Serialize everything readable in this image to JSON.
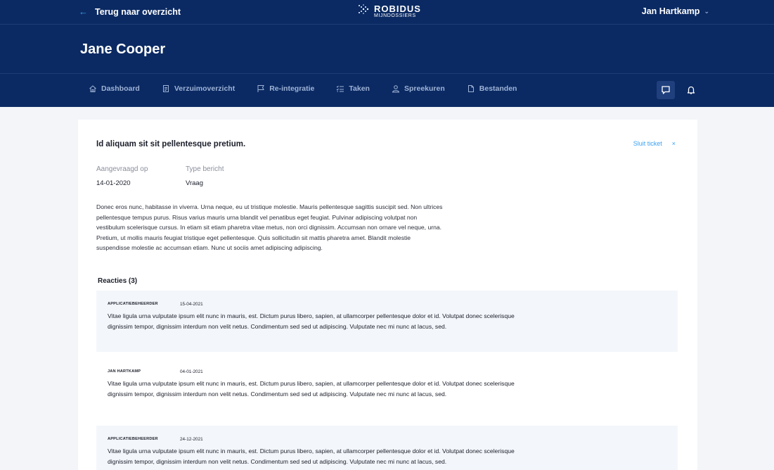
{
  "header": {
    "back_label": "Terug naar overzicht",
    "logo_main": "ROBIDUS",
    "logo_sub": "MIJNDOSSIERS",
    "user_name": "Jan Hartkamp",
    "page_title": "Jane Cooper"
  },
  "nav": {
    "items": [
      {
        "label": "Dashboard",
        "icon": "home-icon"
      },
      {
        "label": "Verzuimoverzicht",
        "icon": "document-icon"
      },
      {
        "label": "Re-integratie",
        "icon": "flag-icon"
      },
      {
        "label": "Taken",
        "icon": "checklist-icon"
      },
      {
        "label": "Spreekuren",
        "icon": "person-icon"
      },
      {
        "label": "Bestanden",
        "icon": "file-icon"
      }
    ],
    "actions": [
      {
        "icon": "chat-icon",
        "active": true
      },
      {
        "icon": "bell-icon",
        "active": false
      }
    ]
  },
  "ticket": {
    "title": "Id aliquam sit sit pellentesque pretium.",
    "close_label": "Sluit ticket",
    "close_icon": "×",
    "requested_label": "Aangevraagd op",
    "requested_value": "14-01-2020",
    "type_label": "Type bericht",
    "type_value": "Vraag",
    "body": "Donec eros nunc, habitasse in viverra. Urna neque, eu ut tristique molestie. Mauris pellentesque sagittis suscipit sed. Non ultrices pellentesque tempus purus. Risus varius mauris urna blandit vel penatibus eget feugiat. Pulvinar adipiscing volutpat non vestibulum scelerisque cursus. In etiam sit etiam pharetra vitae metus, non orci dignissim. Accumsan non ornare vel neque, urna. Pretium, ut mollis mauris feugiat tristique eget pellentesque. Quis sollicitudin sit mattis pharetra amet. Blandit molestie suspendisse molestie ac accumsan etiam. Nunc ut sociis amet adipiscing adipiscing."
  },
  "reactions": {
    "title": "Reacties (3)",
    "items": [
      {
        "author": "APPLICATIEBEHEERDER",
        "date": "15-04-2021",
        "text": "Vitae ligula urna vulputate ipsum elit nunc in mauris, est. Dictum purus libero, sapien, at ullamcorper pellentesque dolor et id. Volutpat donec scelerisque dignissim tempor, dignissim interdum non velit netus. Condimentum sed sed ut adipiscing. Vulputate nec mi nunc at lacus, sed."
      },
      {
        "author": "JAN HARTKAMP",
        "date": "04-01-2021",
        "text": "Vitae ligula urna vulputate ipsum elit nunc in mauris, est. Dictum purus libero, sapien, at ullamcorper pellentesque dolor et id. Volutpat donec scelerisque dignissim tempor, dignissim interdum non velit netus. Condimentum sed sed ut adipiscing. Vulputate nec mi nunc at lacus, sed."
      },
      {
        "author": "APPLICATIEBEHEERDER",
        "date": "24-12-2021",
        "text": "Vitae ligula urna vulputate ipsum elit nunc in mauris, est. Dictum purus libero, sapien, at ullamcorper pellentesque dolor et id. Volutpat donec scelerisque dignissim tempor, dignissim interdum non velit netus. Condimentum sed sed ut adipiscing. Vulputate nec mi nunc at lacus, sed."
      }
    ]
  },
  "colors": {
    "header_bg": "#0b2a63",
    "accent": "#3aa0f0",
    "nav_text": "#9fb3d6",
    "page_bg": "#f3f5f8"
  }
}
